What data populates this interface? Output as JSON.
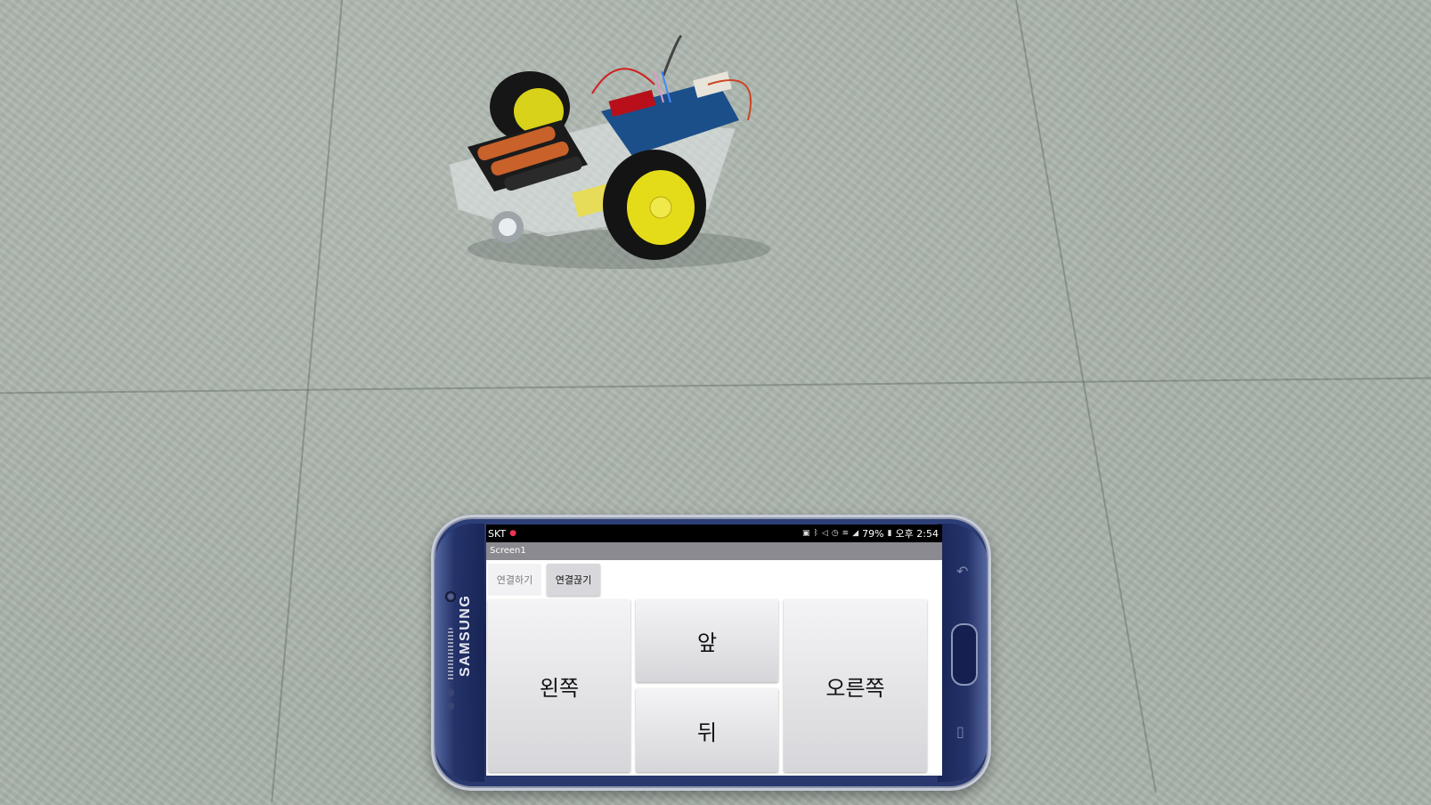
{
  "phone": {
    "brand": "SAMSUNG"
  },
  "status_bar": {
    "carrier": "SKT",
    "battery": "79%",
    "time": "오후 2:54"
  },
  "app": {
    "title": "Screen1",
    "connect_label": "연결하기",
    "disconnect_label": "연결끊기",
    "left_label": "왼쪽",
    "forward_label": "앞",
    "back_label": "뒤",
    "right_label": "오른쪽"
  }
}
